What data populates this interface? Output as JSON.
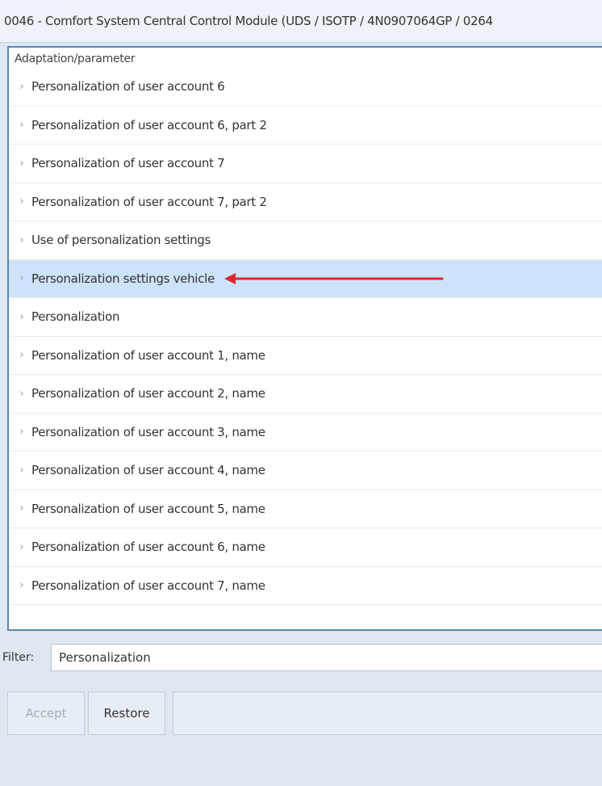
{
  "window": {
    "title": "0046 - Comfort System Central Control Module  (UDS / ISOTP / 4N0907064GP / 0264"
  },
  "list": {
    "group_header": "Adaptation/parameter",
    "items": [
      {
        "label": "Personalization of user account 6",
        "selected": false
      },
      {
        "label": "Personalization of user account 6, part 2",
        "selected": false
      },
      {
        "label": "Personalization of user account 7",
        "selected": false
      },
      {
        "label": "Personalization of user account 7, part 2",
        "selected": false
      },
      {
        "label": "Use of personalization settings",
        "selected": false
      },
      {
        "label": "Personalization settings vehicle",
        "selected": true
      },
      {
        "label": "Personalization",
        "selected": false
      },
      {
        "label": "Personalization of user account 1, name",
        "selected": false
      },
      {
        "label": "Personalization of user account 2, name",
        "selected": false
      },
      {
        "label": "Personalization of user account 3, name",
        "selected": false
      },
      {
        "label": "Personalization of user account 4, name",
        "selected": false
      },
      {
        "label": "Personalization of user account 5, name",
        "selected": false
      },
      {
        "label": "Personalization of user account 6, name",
        "selected": false
      },
      {
        "label": "Personalization of user account 7, name",
        "selected": false
      }
    ],
    "chevron_glyph": "›",
    "annotation_arrow_color": "#e0262b"
  },
  "filter": {
    "label": "Filter:",
    "value": "Personalization"
  },
  "buttons": {
    "accept_label": "Accept",
    "accept_enabled": false,
    "restore_label": "Restore"
  },
  "colors": {
    "selected_row": "#cce3f9",
    "panel_border": "#5b86b3",
    "background": "#dfe7f1"
  }
}
